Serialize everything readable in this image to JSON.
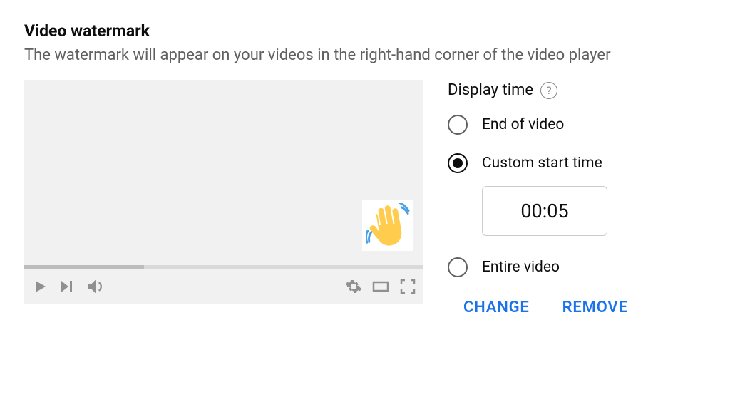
{
  "section": {
    "title": "Video watermark",
    "description": "The watermark will appear on your videos in the right-hand corner of the video player"
  },
  "options_panel": {
    "heading": "Display time",
    "radios": {
      "end": "End of video",
      "custom": "Custom start time",
      "entire": "Entire video"
    },
    "selected": "custom",
    "time_value": "00:05"
  },
  "actions": {
    "change": "CHANGE",
    "remove": "REMOVE"
  }
}
